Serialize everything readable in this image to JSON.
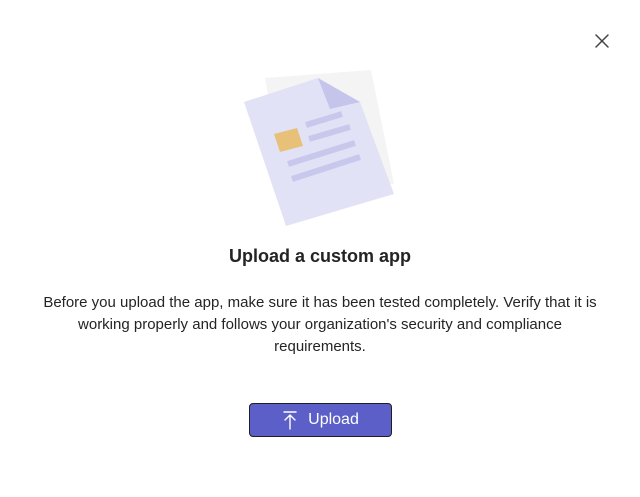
{
  "dialog": {
    "title": "Upload a custom app",
    "description": "Before you upload the app, make sure it has been tested completely. Verify that it is working properly and follows your organization's security and compliance requirements.",
    "upload_label": "Upload",
    "icons": {
      "close": "close-icon",
      "upload": "arrow-up-to-line-icon",
      "illustration": "document-illustration"
    }
  },
  "colors": {
    "primary": "#5b5fc7",
    "text": "#242424",
    "illustration_page": "#e2e2f6",
    "illustration_fold": "#c5c5ec",
    "illustration_lines": "#c8c8ec",
    "illustration_square": "#e8c178",
    "illustration_back": "#f4f4f4"
  }
}
